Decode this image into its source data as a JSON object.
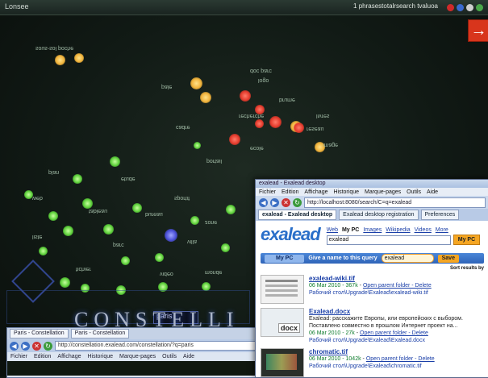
{
  "window_top": {
    "left_title": "Lonsee",
    "right_status": "1 phrasestotalrsearch tvaluoa",
    "tray_icons": [
      "network-icon",
      "speaker-icon",
      "clock-icon",
      "battery-icon"
    ]
  },
  "visualization": {
    "title": "CONSTELLATION",
    "title_visible": "CONSTELLI",
    "search_value": "paris",
    "labels": [
      "sous-sol poche",
      "doc parc",
      "logo",
      "pale",
      "brume",
      "recherche",
      "livres",
      "cadre",
      "reseau",
      "ecole",
      "image",
      "portail",
      "plan",
      "etude",
      "web",
      "sportif",
      "tableau",
      "bureau",
      "zone",
      "liste",
      "parc",
      "villa",
      "fichier",
      "video",
      "monde"
    ],
    "colors": {
      "yellow": "#f0b23a",
      "red": "#e43a2c",
      "green": "#5ccf3a",
      "blue": "#4a4fd6"
    }
  },
  "back_browser": {
    "tabs": [
      "Paris - Constellation",
      "Paris - Constellation"
    ],
    "url": "http://constellation.exalead.com/constellation/?q=paris",
    "menu": [
      "Fichier",
      "Edition",
      "Affichage",
      "Historique",
      "Marque-pages",
      "Outils",
      "Aide"
    ]
  },
  "front_browser": {
    "title": "exalead - Exalead desktop",
    "menu": [
      "Fichier",
      "Edition",
      "Affichage",
      "Historique",
      "Marque-pages",
      "Outils",
      "Aide"
    ],
    "url": "http://localhost:8080/search/C=q=exalead",
    "tabs": [
      "exalead - Exalead desktop",
      "Exalead desktop registration",
      "Preferences"
    ],
    "logo": "exalead",
    "search_links": [
      "Web",
      "My PC",
      "Images",
      "Wikipedia",
      "Videos",
      "More"
    ],
    "search_value": "exalead",
    "search_button": "My PC",
    "bluebar": {
      "tab": "My PC",
      "hint": "Give a name to this query",
      "query": "exalead",
      "save": "Save"
    },
    "sort": "Sort results by",
    "results": [
      {
        "title": "exalead-wiki.tif",
        "date": "06 Mar 2010 - 367k",
        "links": "Open parent folder - Delete",
        "path": "Рабочий стол\\Upgrade\\Exalead\\exalead-wiki.tif",
        "thumb": "wiki"
      },
      {
        "title": "Exalead.docx",
        "snippet": "Exalead: расскажите Европы, или европейских с выбором. Поставлено совместно в прошлом Интернет проект на...",
        "date": "06 Mar 2010 - 27k",
        "links": "Open parent folder - Delete",
        "path": "Рабочий стол\\Upgrade\\Exalead\\Exalead.docx",
        "thumb": "docx",
        "thumb_label": "docx"
      },
      {
        "title": "chromatic.tif",
        "date": "06 Mar 2010 - 1042k",
        "links": "Open parent folder - Delete",
        "path": "Рабочий стол\\Upgrade\\Exalead\\chromatic.tif",
        "thumb": "chrom"
      }
    ]
  }
}
